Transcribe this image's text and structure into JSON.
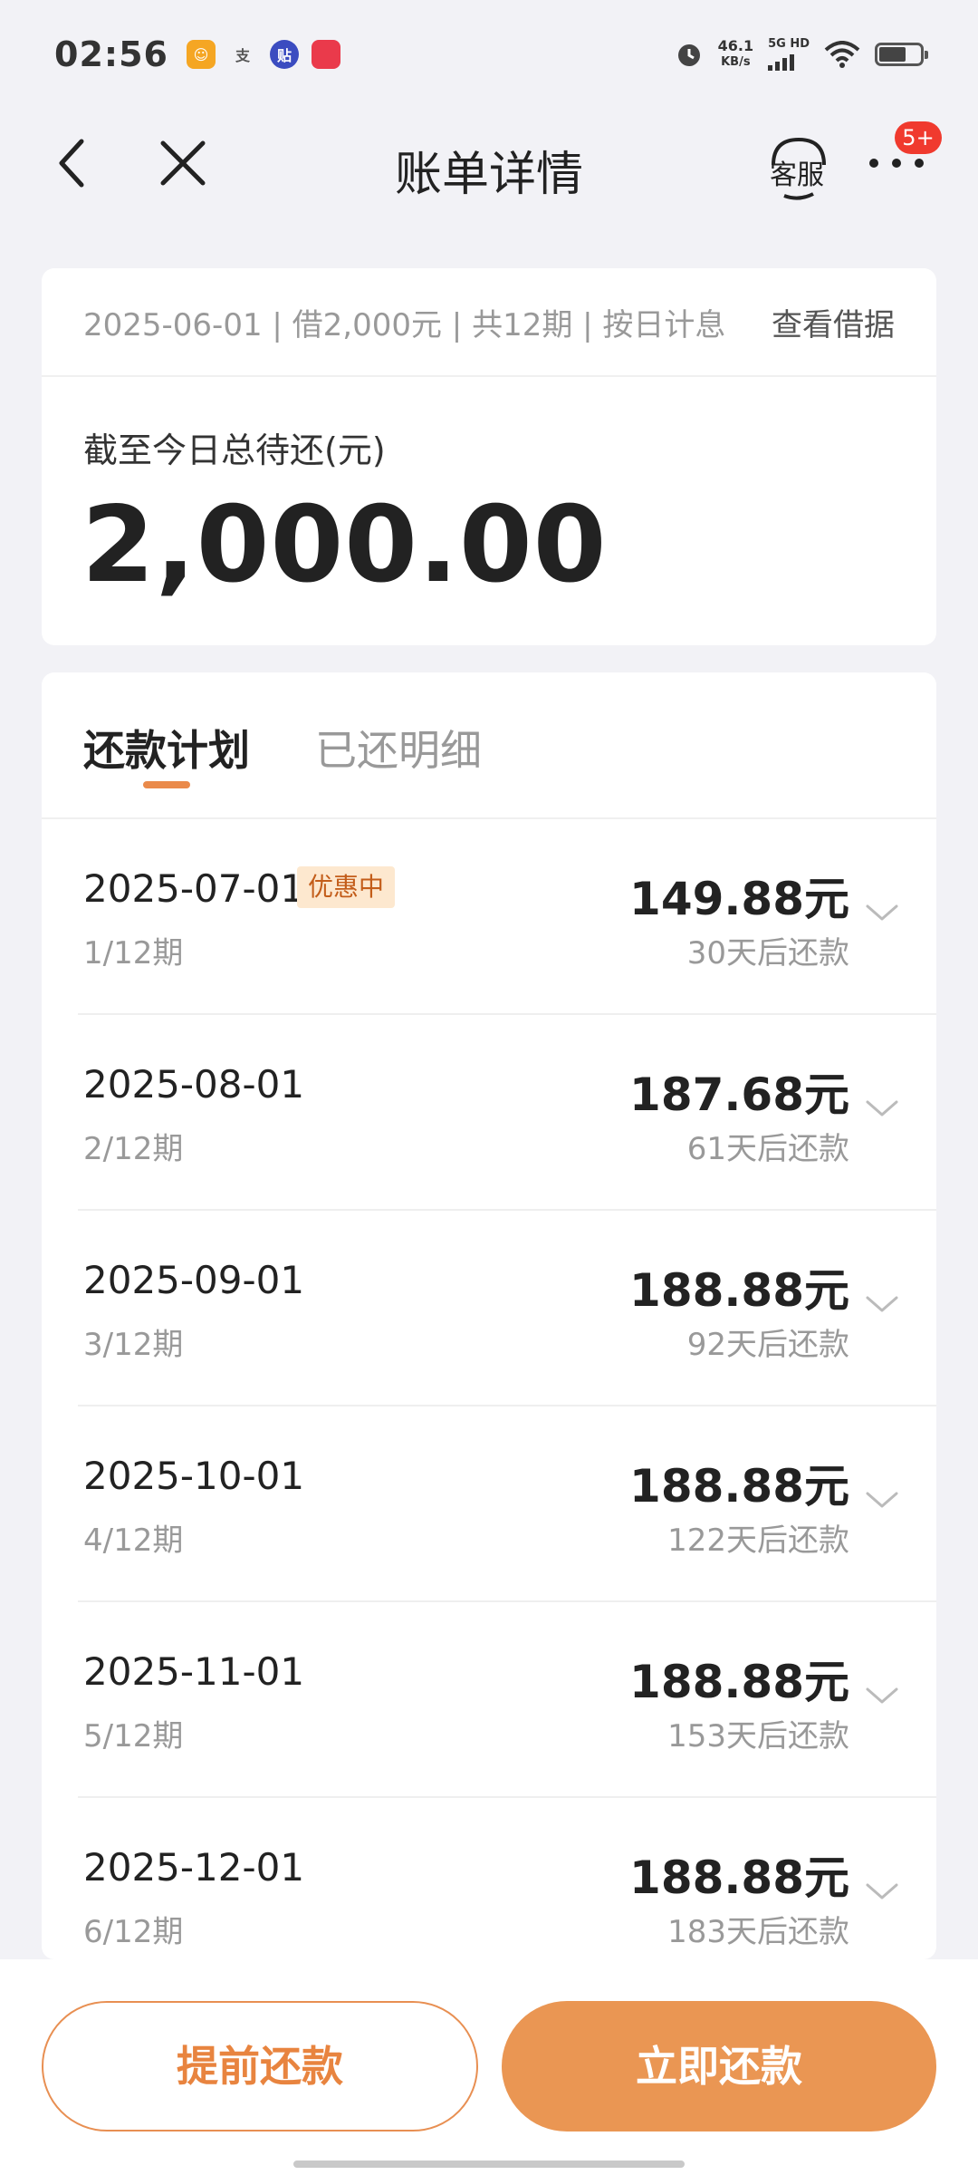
{
  "status_bar": {
    "time": "02:56",
    "net_speed_value": "46.1",
    "net_speed_unit": "KB/s",
    "network_type": "5G HD",
    "app_icons": [
      {
        "name": "app-icon-1",
        "glyph": "",
        "color": "#f5a623"
      },
      {
        "name": "alipay-icon",
        "glyph": "支",
        "color": "#555555"
      },
      {
        "name": "app-icon-3",
        "glyph": "贴",
        "color": "#3b4cc0"
      },
      {
        "name": "xiaohongshu-icon",
        "glyph": "",
        "color": "#ea3a4b"
      }
    ]
  },
  "nav": {
    "title": "账单详情",
    "service_label": "客服",
    "badge": "5+"
  },
  "summary": {
    "loan_info": "2025-06-01 | 借2,000元 | 共12期 | 按日计息",
    "view_contract": "查看借据",
    "total_label": "截至今日总待还(元)",
    "total_amount": "2,000.00"
  },
  "tabs": {
    "active": "还款计划",
    "inactive": "已还明细"
  },
  "plan_items": [
    {
      "date": "2025-07-01",
      "badge": "优惠中",
      "period": "1/12期",
      "amount": "149.88元",
      "due": "30天后还款"
    },
    {
      "date": "2025-08-01",
      "badge": "",
      "period": "2/12期",
      "amount": "187.68元",
      "due": "61天后还款"
    },
    {
      "date": "2025-09-01",
      "badge": "",
      "period": "3/12期",
      "amount": "188.88元",
      "due": "92天后还款"
    },
    {
      "date": "2025-10-01",
      "badge": "",
      "period": "4/12期",
      "amount": "188.88元",
      "due": "122天后还款"
    },
    {
      "date": "2025-11-01",
      "badge": "",
      "period": "5/12期",
      "amount": "188.88元",
      "due": "153天后还款"
    },
    {
      "date": "2025-12-01",
      "badge": "",
      "period": "6/12期",
      "amount": "188.88元",
      "due": "183天后还款"
    }
  ],
  "buttons": {
    "prepay": "提前还款",
    "repay_now": "立即还款"
  },
  "colors": {
    "accent": "#ea9653",
    "badge_bg": "#fde8cf",
    "badge_text": "#c35d1a",
    "notification": "#f03a2e"
  }
}
